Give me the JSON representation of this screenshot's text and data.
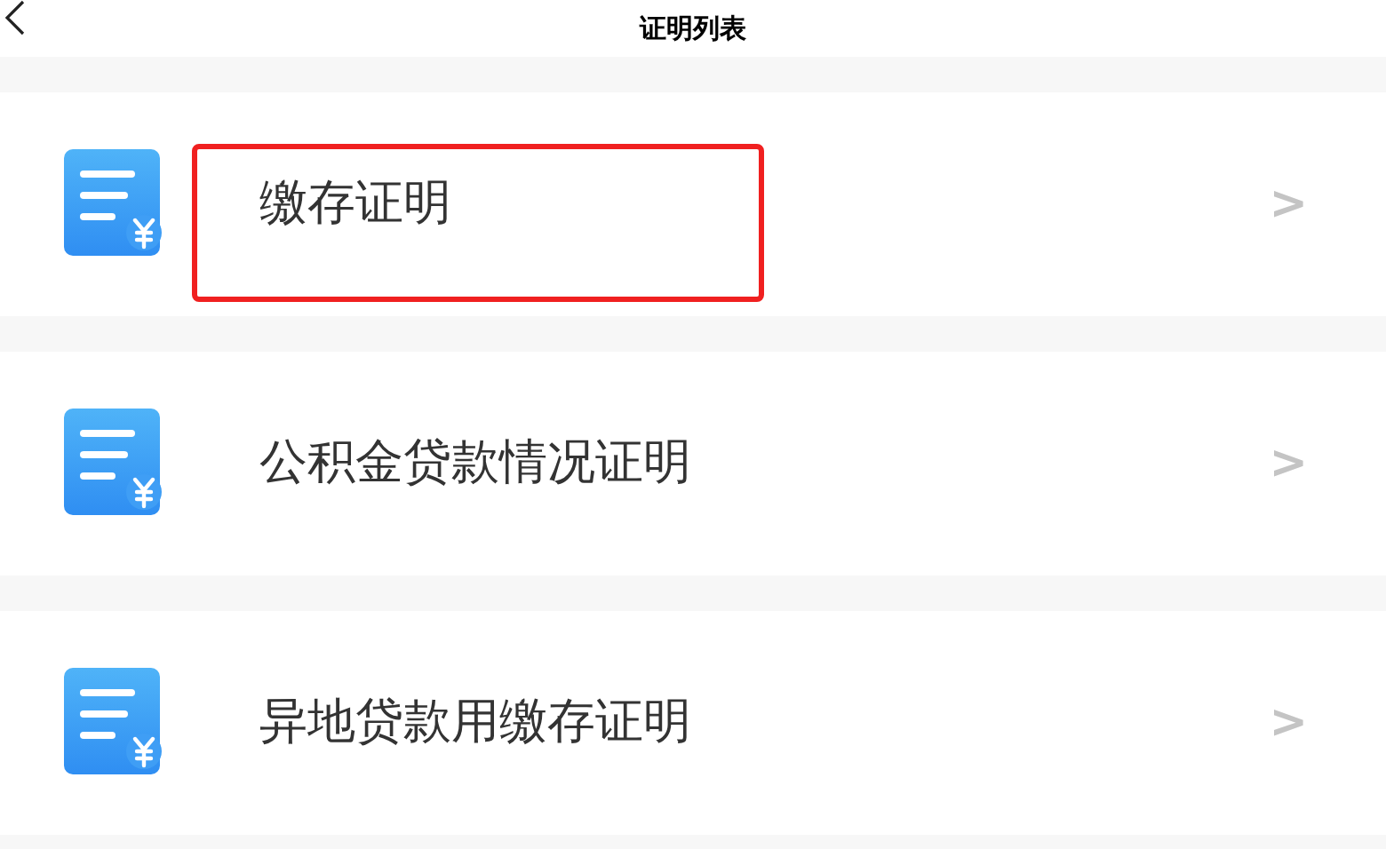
{
  "header": {
    "title": "证明列表"
  },
  "items": [
    {
      "label": "缴存证明",
      "chevron": ">",
      "highlighted": true
    },
    {
      "label": "公积金贷款情况证明",
      "chevron": ">",
      "highlighted": false
    },
    {
      "label": "异地贷款用缴存证明",
      "chevron": ">",
      "highlighted": false
    }
  ]
}
